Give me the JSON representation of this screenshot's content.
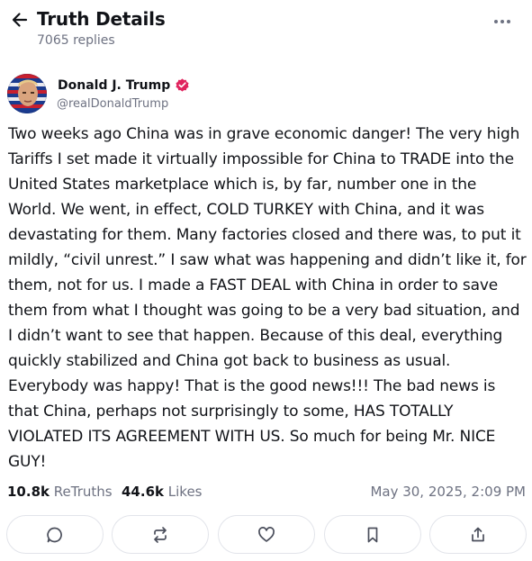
{
  "header": {
    "title": "Truth Details",
    "replies": "7065 replies"
  },
  "post": {
    "author_name": "Donald J. Trump",
    "author_handle": "@realDonaldTrump",
    "text": "Two weeks ago China was in grave economic danger! The very high Tariffs I set made it virtually impossible for China to TRADE into the United States marketplace which is, by far, number one in the World. We went, in effect, COLD TURKEY with China, and it was devastating for them. Many factories closed and there was, to put it mildly, “civil unrest.” I saw what was happening and didn’t like it, for them, not for us. I made a FAST DEAL with China in order to save them from what I thought was going to be a very bad situation, and I didn’t want to see that happen. Because of this deal, everything quickly stabilized and China got back to business as usual. Everybody was happy! That is the good news!!! The bad news is that China, perhaps not surprisingly to some, HAS TOTALLY VIOLATED ITS AGREEMENT WITH US. So much for being Mr. NICE GUY!",
    "retruths_count": "10.8k",
    "retruths_label": "ReTruths",
    "likes_count": "44.6k",
    "likes_label": "Likes",
    "timestamp": "May 30, 2025, 2:09 PM"
  },
  "icons": {
    "back": "arrow-left-icon",
    "more": "more-horizontal-icon",
    "verified": "verified-badge-icon",
    "reply": "comment-icon",
    "retruth": "repost-icon",
    "like": "heart-icon",
    "bookmark": "bookmark-icon",
    "share": "share-icon"
  },
  "colors": {
    "verified": "#e0245e",
    "muted_text": "#6e7282",
    "primary_text": "#111318",
    "border": "#e2e4ea"
  }
}
